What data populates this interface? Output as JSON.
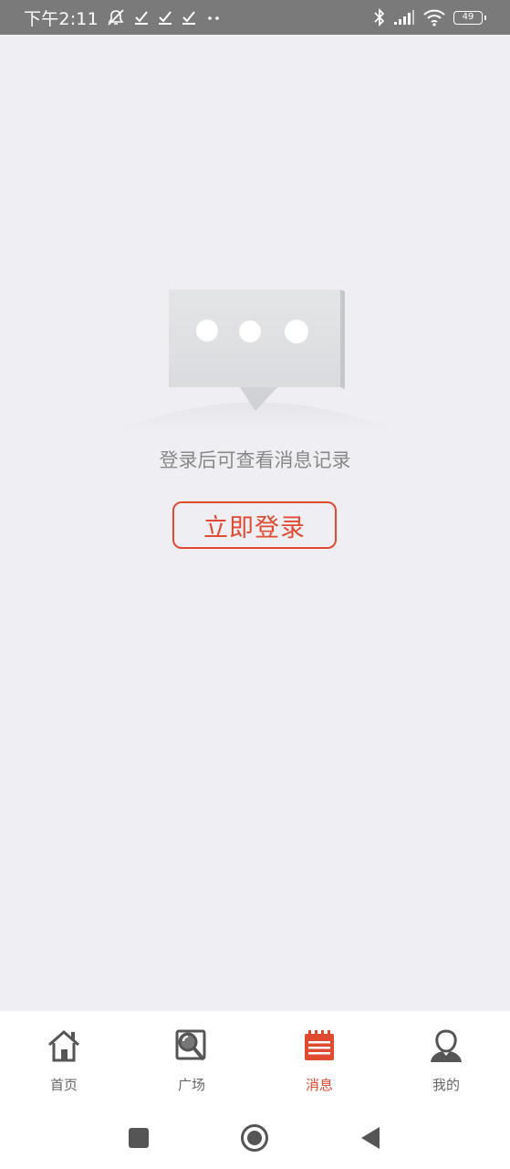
{
  "status_bar": {
    "time": "下午2:11",
    "battery": "49",
    "icons": [
      "mute-icon",
      "check-icon",
      "check-icon",
      "check-icon",
      "dots-icon",
      "bluetooth-icon",
      "signal-icon",
      "wifi-icon",
      "battery-icon"
    ]
  },
  "empty_state": {
    "message": "登录后可查看消息记录",
    "login_button": "立即登录",
    "illustration": "chat-bubble-icon"
  },
  "tabbar": {
    "items": [
      {
        "label": "首页",
        "icon": "home-icon",
        "active": false
      },
      {
        "label": "广场",
        "icon": "search-square-icon",
        "active": false
      },
      {
        "label": "消息",
        "icon": "calendar-message-icon",
        "active": true
      },
      {
        "label": "我的",
        "icon": "user-icon",
        "active": false
      }
    ]
  },
  "colors": {
    "accent": "#e04a31",
    "background": "#efeef3",
    "status_bar": "#7a7a7a",
    "inactive": "#666666"
  },
  "navbar": {
    "buttons": [
      "recents-button",
      "home-button",
      "back-button"
    ]
  }
}
